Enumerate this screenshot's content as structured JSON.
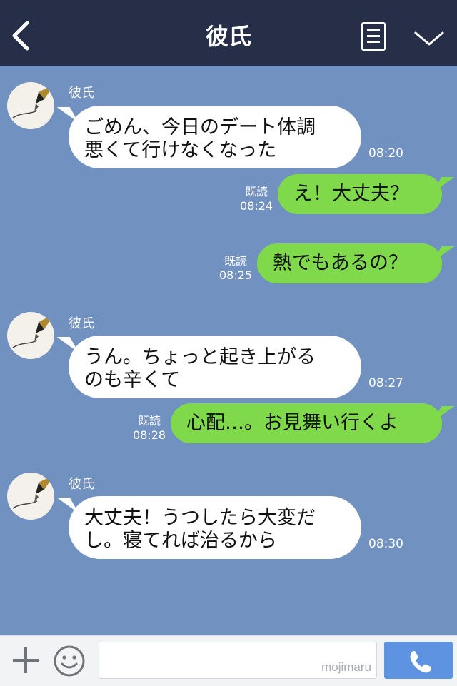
{
  "header": {
    "title": "彼氏",
    "back_icon": "chevron-left-icon",
    "menu_icon": "menu-icon",
    "collapse_icon": "chevron-down-icon"
  },
  "messages": [
    {
      "sender": "彼氏",
      "lines": [
        "ごめん、今日のデート体調",
        "悪くて行けなくなった"
      ],
      "time": "08:20",
      "direction": "incoming"
    },
    {
      "lines": [
        "え！大丈夫？"
      ],
      "read": "既読",
      "time": "08:24",
      "direction": "outgoing"
    },
    {
      "lines": [
        "熱でもあるの？"
      ],
      "read": "既読",
      "time": "08:25",
      "direction": "outgoing"
    },
    {
      "sender": "彼氏",
      "lines": [
        "うん。ちょっと起き上がる",
        "のも辛くて"
      ],
      "time": "08:27",
      "direction": "incoming"
    },
    {
      "lines": [
        "心配…。お見舞い行くよ"
      ],
      "read": "既読",
      "time": "08:28",
      "direction": "outgoing"
    },
    {
      "sender": "彼氏",
      "lines": [
        "大丈夫！うつしたら大変だ",
        "し。寝てれば治るから"
      ],
      "time": "08:30",
      "direction": "incoming"
    }
  ],
  "footer": {
    "input_value": "",
    "watermark": "mojimaru",
    "plus_icon": "plus-icon",
    "emoji_icon": "smiley-icon",
    "call_icon": "phone-icon"
  },
  "colors": {
    "header_bg": "#262f47",
    "chat_bg": "#7192c1",
    "outgoing_bubble": "#80d94a",
    "incoming_bubble": "#ffffff",
    "call_button": "#5d93e0"
  }
}
